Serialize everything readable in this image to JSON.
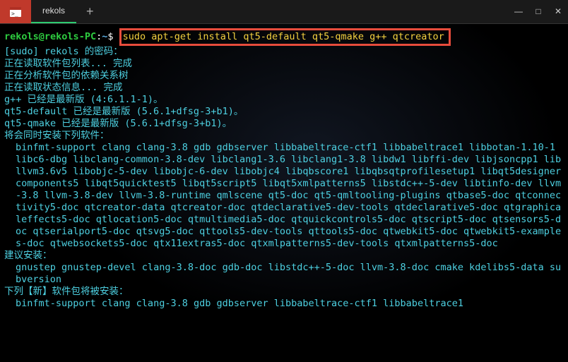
{
  "tabs": {
    "active_label": "rekols",
    "new_tab_symbol": "+"
  },
  "window_controls": {
    "min": "—",
    "max": "□",
    "close": "✕"
  },
  "prompt": {
    "user": "rekols",
    "at": "@",
    "host": "rekols-PC",
    "colon": ":",
    "path": "~",
    "dollar": "$"
  },
  "command": "sudo apt-get install qt5-default qt5-qmake g++ qtcreator",
  "output": {
    "l1": "[sudo] rekols 的密码：",
    "l2": "正在读取软件包列表... 完成",
    "l3": "正在分析软件包的依赖关系树",
    "l4": "正在读取状态信息... 完成",
    "l5": "g++ 已经是最新版 (4:6.1.1-1)。",
    "l6": "qt5-default 已经是最新版 (5.6.1+dfsg-3+b1)。",
    "l7": "qt5-qmake 已经是最新版 (5.6.1+dfsg-3+b1)。",
    "l8": "将会同时安装下列软件：",
    "pkgs1": "binfmt-support clang clang-3.8 gdb gdbserver libbabeltrace-ctf1 libbabeltrace1 libbotan-1.10-1 libc6-dbg libclang-common-3.8-dev libclang1-3.6 libclang1-3.8 libdw1 libffi-dev libjsoncpp1 libllvm3.6v5 libobjc-5-dev libobjc-6-dev libobjc4 libqbscore1 libqbsqtprofilesetup1 libqt5designercomponents5 libqt5quicktest5 libqt5script5 libqt5xmlpatterns5 libstdc++-5-dev libtinfo-dev llvm-3.8 llvm-3.8-dev llvm-3.8-runtime qmlscene qt5-doc qt5-qmltooling-plugins qtbase5-doc qtconnectivity5-doc qtcreator-data qtcreator-doc qtdeclarative5-dev-tools qtdeclarative5-doc qtgraphicaleffects5-doc qtlocation5-doc qtmultimedia5-doc qtquickcontrols5-doc qtscript5-doc qtsensors5-doc qtserialport5-doc qtsvg5-doc qttools5-dev-tools qttools5-doc qtwebkit5-doc qtwebkit5-examples-doc qtwebsockets5-doc qtx11extras5-doc qtxmlpatterns5-dev-tools qtxmlpatterns5-doc",
    "l9": "建议安装：",
    "pkgs2": "gnustep gnustep-devel clang-3.8-doc gdb-doc libstdc++-5-doc llvm-3.8-doc cmake kdelibs5-data subversion",
    "l10": "下列【新】软件包将被安装：",
    "pkgs3": "binfmt-support clang clang-3.8 gdb gdbserver libbabeltrace-ctf1 libbabeltrace1"
  }
}
